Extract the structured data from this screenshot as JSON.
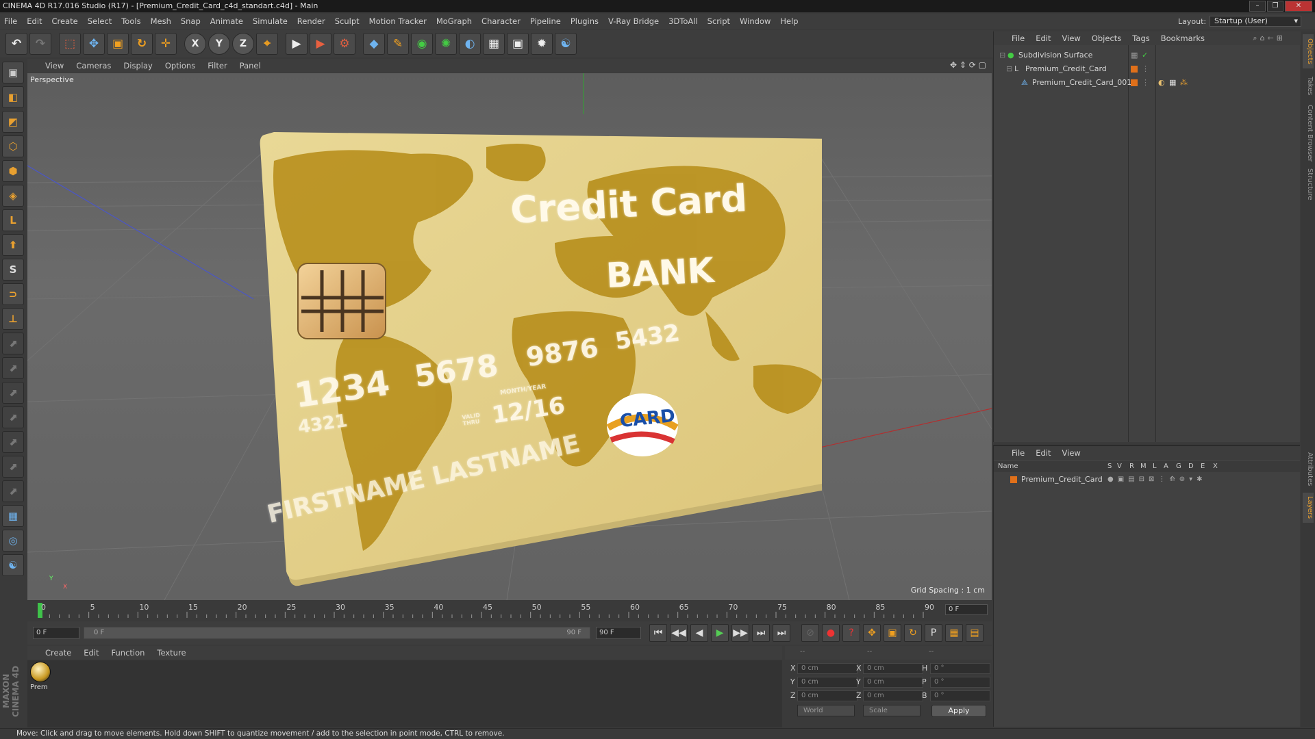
{
  "window": {
    "title": "CINEMA 4D R17.016 Studio (R17) - [Premium_Credit_Card_c4d_standart.c4d] - Main"
  },
  "menubar": [
    "File",
    "Edit",
    "Create",
    "Select",
    "Tools",
    "Mesh",
    "Snap",
    "Animate",
    "Simulate",
    "Render",
    "Sculpt",
    "Motion Tracker",
    "MoGraph",
    "Character",
    "Pipeline",
    "Plugins",
    "V-Ray Bridge",
    "3DToAll",
    "Script",
    "Window",
    "Help"
  ],
  "layout": {
    "label": "Layout:",
    "value": "Startup (User)"
  },
  "toolbar": {
    "undo": "↶",
    "redo": "↷",
    "select": "⬚",
    "move": "✥",
    "scale": "▣",
    "rotate": "↻",
    "transform": "✛",
    "axis_x": "X",
    "axis_y": "Y",
    "axis_z": "Z",
    "coord": "⌖",
    "render_view": "▶",
    "render_pic": "▶",
    "render_settings": "⚙",
    "cube": "◆",
    "pen": "✎",
    "subdiv": "◉",
    "array": "✺",
    "deformer": "◐",
    "floor": "▦",
    "camera": "▣",
    "light": "✹",
    "python": "☯"
  },
  "lefttools": [
    "▣",
    "◧",
    "◩",
    "⬡",
    "⬢",
    "◈",
    "L",
    "⬆",
    "S",
    "⊃",
    "⊥",
    "⬈",
    "⬈",
    "⬈",
    "⬈",
    "⬈",
    "⬈",
    "⬈",
    "▦",
    "◎",
    "☯"
  ],
  "maxon_logo": "MAXON CINEMA 4D",
  "viewport": {
    "menu": [
      "View",
      "Cameras",
      "Display",
      "Options",
      "Filter",
      "Panel"
    ],
    "label": "Perspective",
    "grid_spacing": "Grid Spacing : 1 cm",
    "axis_y": "Y",
    "axis_x": "X",
    "nav_icons": "✥ ⇕ ⟳ ▢"
  },
  "card": {
    "title": "Credit Card",
    "bank": "BANK",
    "num1": "1234",
    "num2": "5678",
    "num3": "9876",
    "num4": "5432",
    "small_num": "4321",
    "valid": "12/16",
    "month_year": "MONTH/YEAR",
    "valid_thru": "VALID THRU",
    "name": "FIRSTNAME LASTNAME",
    "logo": "CARD"
  },
  "timeline": {
    "ticks": [
      "0",
      "5",
      "10",
      "15",
      "20",
      "25",
      "30",
      "35",
      "40",
      "45",
      "50",
      "55",
      "60",
      "65",
      "70",
      "75",
      "80",
      "85",
      "90"
    ],
    "current_frame": "0 F"
  },
  "transport": {
    "start": "0 F",
    "slider_start": "0 F",
    "slider_end": "90 F",
    "end": "90 F",
    "buttons": [
      "⏮",
      "◀◀",
      "◀",
      "▶",
      "▶▶",
      "⏭",
      "⏭"
    ],
    "key_buttons": [
      "⊘",
      "●",
      "?",
      "✥",
      "▣",
      "↻",
      "P",
      "▦",
      "▤"
    ]
  },
  "material_manager": {
    "menu": [
      "Create",
      "Edit",
      "Function",
      "Texture"
    ],
    "material_name": "Prem"
  },
  "coordinates": {
    "head": [
      "--",
      "--",
      "--"
    ],
    "rows": [
      {
        "l1": "X",
        "v1": "0 cm",
        "l2": "X",
        "v2": "0 cm",
        "l3": "H",
        "v3": "0 °"
      },
      {
        "l1": "Y",
        "v1": "0 cm",
        "l2": "Y",
        "v2": "0 cm",
        "l3": "P",
        "v3": "0 °"
      },
      {
        "l1": "Z",
        "v1": "0 cm",
        "l2": "Z",
        "v2": "0 cm",
        "l3": "B",
        "v3": "0 °"
      }
    ],
    "mode": "World",
    "transform": "Scale",
    "apply": "Apply"
  },
  "object_manager": {
    "menu": [
      "File",
      "Edit",
      "View",
      "Objects",
      "Tags",
      "Bookmarks"
    ],
    "objects": [
      "Subdivision Surface",
      "Premium_Credit_Card",
      "Premium_Credit_Card_001"
    ]
  },
  "layer_manager": {
    "menu": [
      "File",
      "Edit",
      "View"
    ],
    "columns": [
      "Name",
      "S",
      "V",
      "R",
      "M",
      "L",
      "A",
      "G",
      "D",
      "E",
      "X"
    ],
    "layer": "Premium_Credit_Card"
  },
  "right_tabs": [
    "Objects",
    "Takes",
    "Content Browser",
    "Structure",
    "Attributes",
    "Layers"
  ],
  "status": "Move: Click and drag to move elements. Hold down SHIFT to quantize movement / add to the selection in point mode, CTRL to remove.",
  "colors": {
    "accent": "#e8a030",
    "card_gold": "#e2cf88",
    "map_gold": "#b8901e"
  }
}
